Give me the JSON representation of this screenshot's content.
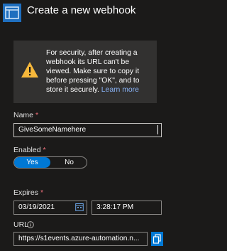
{
  "header": {
    "title": "Create a new webhook",
    "icon": "webhook-panel-icon"
  },
  "warning": {
    "icon": "warning-icon",
    "text": "For security, after creating a webhook its URL can't be viewed. Make sure to copy it before pressing \"OK\", and to store it securely.",
    "link": "Learn more"
  },
  "name_field": {
    "label": "Name",
    "required_mark": "*",
    "value": "GiveSomeNamehere"
  },
  "enabled_field": {
    "label": "Enabled",
    "required_mark": "*",
    "options": [
      "Yes",
      "No"
    ],
    "selected": "Yes"
  },
  "expires_field": {
    "label": "Expires",
    "required_mark": "*",
    "date": "03/19/2021",
    "time": "3:28:17 PM",
    "calendar_icon": "calendar-icon"
  },
  "url_field": {
    "label": "URL",
    "info_icon": "info-icon",
    "value": "https://s1events.azure-automation.n...",
    "copy_icon": "copy-icon"
  },
  "colors": {
    "accent": "#0078d4",
    "background": "#1b1a19",
    "required": "#f1707b",
    "warning": "#f7b83b"
  }
}
